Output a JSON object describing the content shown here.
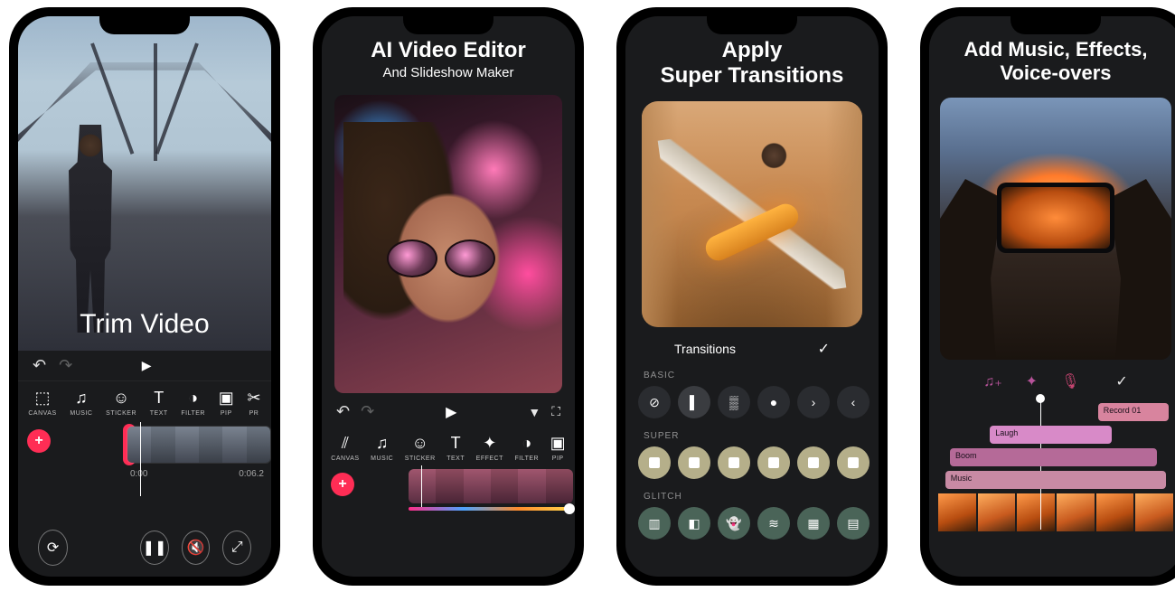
{
  "phone1": {
    "overlay_title": "Trim Video",
    "controls": {
      "undo": "↶",
      "redo": "↷",
      "play": "▶"
    },
    "tools": [
      {
        "icon": "⬚",
        "label": "CANVAS"
      },
      {
        "icon": "♫",
        "label": "MUSIC"
      },
      {
        "icon": "☺",
        "label": "STICKER"
      },
      {
        "icon": "T",
        "label": "TEXT"
      },
      {
        "icon": "◑",
        "label": "FILTER"
      },
      {
        "icon": "▣",
        "label": "PIP"
      },
      {
        "icon": "✂",
        "label": "PR"
      }
    ],
    "add": "+",
    "time_start": "0:00",
    "time_end": "0:06.2",
    "bottom": {
      "rotate": "⟳",
      "pause": "❚❚",
      "mute": "🔇",
      "fullscreen": "⤢"
    }
  },
  "phone2": {
    "title": "AI Video Editor",
    "subtitle": "And Slideshow Maker",
    "controls": {
      "undo": "↶",
      "redo": "↷",
      "play": "▶",
      "filter": "▼",
      "fullscreen": "⛶"
    },
    "tools": [
      {
        "icon": "⫽",
        "label": "CANVAS"
      },
      {
        "icon": "♫",
        "label": "MUSIC"
      },
      {
        "icon": "☺",
        "label": "STICKER"
      },
      {
        "icon": "T",
        "label": "TEXT"
      },
      {
        "icon": "✦",
        "label": "EFFECT"
      },
      {
        "icon": "◑",
        "label": "FILTER"
      },
      {
        "icon": "▣",
        "label": "PIP"
      }
    ],
    "add": "+"
  },
  "phone3": {
    "title_l1": "Apply",
    "title_l2": "Super Transitions",
    "section_label": "Transitions",
    "check": "✓",
    "cat_basic": "BASIC",
    "cat_super": "SUPER",
    "cat_glitch": "GLITCH",
    "basic_icons": [
      "⊘",
      "▌",
      "▒",
      "●",
      "›",
      "‹"
    ]
  },
  "phone4": {
    "title_l1": "Add Music, Effects,",
    "title_l2": "Voice-overs",
    "icons": {
      "music": "♫₊",
      "sparkle": "✦",
      "mic": "🎙",
      "check": "✓"
    },
    "tracks": {
      "record": "Record 01",
      "laugh": "Laugh",
      "boom": "Boom",
      "music": "Music"
    }
  }
}
